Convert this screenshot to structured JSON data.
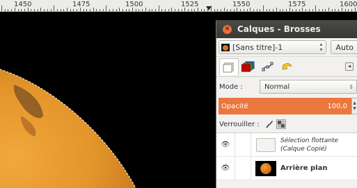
{
  "ruler": {
    "labels": [
      "1450",
      "1475",
      "1500",
      "1525",
      "1550",
      "1575",
      "1600"
    ]
  },
  "dock": {
    "title": "Calques - Brosses",
    "close_icon": "close-icon",
    "image_menu": {
      "value": "[Sans titre]-1",
      "auto_label": "Auto"
    },
    "tabs": [
      "layers-icon",
      "channels-icon",
      "paths-icon",
      "undo-icon"
    ],
    "mode_label": "Mode :",
    "mode_value": "Normal",
    "opacity_label": "Opacité",
    "opacity_value": "100,0",
    "lock_label": "Verrouiller :",
    "lock_icons": [
      "brush-lock-icon",
      "alpha-lock-icon"
    ],
    "layers": [
      {
        "line1": "Sélection flottante",
        "line2": "(Calque Copié)",
        "visible": true,
        "style": "italic"
      },
      {
        "line1": "Arrière plan",
        "line2": "",
        "visible": true,
        "style": "bold"
      }
    ]
  },
  "colors": {
    "accent": "#e9773e",
    "titlebar": "#3f3e3a",
    "planet": "#e2962a",
    "canvas": "#000000"
  }
}
